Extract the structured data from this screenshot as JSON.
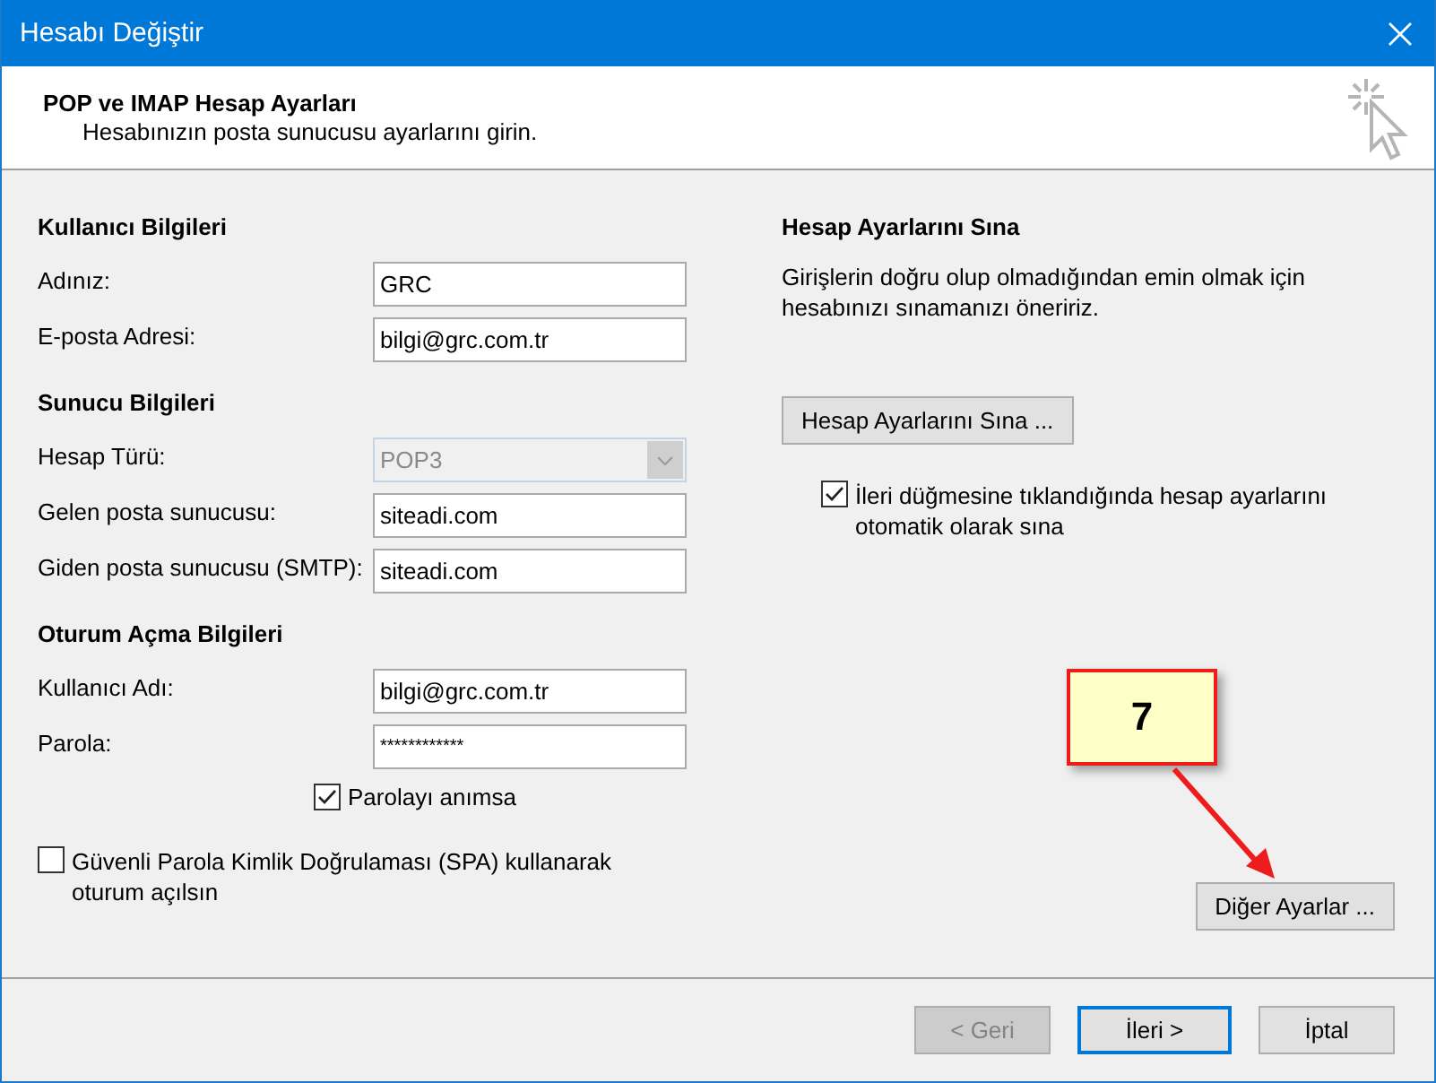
{
  "window": {
    "title": "Hesabı Değiştir"
  },
  "header": {
    "title": "POP ve IMAP Hesap Ayarları",
    "subtitle": "Hesabınızın posta sunucusu ayarlarını girin."
  },
  "sections": [
    {
      "heading": "Kullanıcı Bilgileri",
      "fields": [
        {
          "label": "Adınız:",
          "value": "GRC",
          "kind": "text"
        },
        {
          "label": "E-posta Adresi:",
          "value": "bilgi@grc.com.tr",
          "kind": "text"
        }
      ]
    },
    {
      "heading": "Sunucu Bilgileri",
      "fields": [
        {
          "label": "Hesap Türü:",
          "value": "POP3",
          "kind": "select",
          "disabled": true
        },
        {
          "label": "Gelen posta sunucusu:",
          "value": "siteadi.com",
          "kind": "text"
        },
        {
          "label": "Giden posta sunucusu (SMTP):",
          "value": "siteadi.com",
          "kind": "text"
        }
      ]
    },
    {
      "heading": "Oturum Açma Bilgileri",
      "fields": [
        {
          "label": "Kullanıcı Adı:",
          "value": "bilgi@grc.com.tr",
          "kind": "text"
        },
        {
          "label": "Parola:",
          "value": "************",
          "kind": "password"
        }
      ]
    }
  ],
  "remember_password": {
    "label": "Parolayı anımsa",
    "checked": true
  },
  "spa": {
    "label": "Güvenli Parola Kimlik Doğrulaması (SPA) kullanarak oturum açılsın",
    "checked": false
  },
  "test": {
    "heading": "Hesap Ayarlarını Sına",
    "description": "Girişlerin doğru olup olmadığından emin olmak için hesabınızı sınamanızı öneririz.",
    "button": "Hesap Ayarlarını Sına ...",
    "auto_test": {
      "label": "İleri düğmesine tıklandığında hesap ayarlarını otomatik olarak sına",
      "checked": true
    }
  },
  "more_settings": "Diğer Ayarlar ...",
  "callout": {
    "label": "7"
  },
  "buttons": [
    {
      "label": "< Geri",
      "disabled": true,
      "focused": false
    },
    {
      "label": "İleri >",
      "disabled": false,
      "focused": true
    },
    {
      "label": "İptal",
      "disabled": false,
      "focused": false
    }
  ]
}
